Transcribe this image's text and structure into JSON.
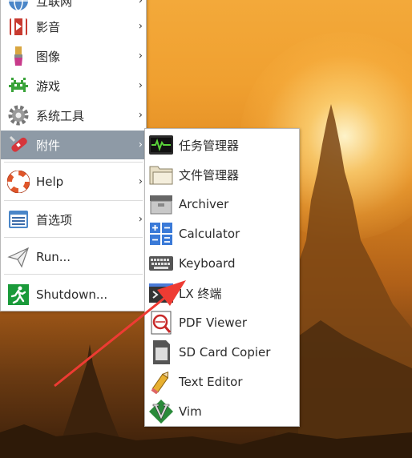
{
  "main_menu": {
    "items": [
      {
        "label": "互联网",
        "icon": "globe-icon"
      },
      {
        "label": "影音",
        "icon": "media-icon"
      },
      {
        "label": "图像",
        "icon": "paintbrush-icon"
      },
      {
        "label": "游戏",
        "icon": "space-invader-icon"
      },
      {
        "label": "系统工具",
        "icon": "gear-icon"
      },
      {
        "label": "附件",
        "icon": "swiss-knife-icon",
        "active": true
      },
      {
        "label": "Help",
        "icon": "lifebuoy-icon"
      },
      {
        "label": "首选项",
        "icon": "preferences-icon"
      },
      {
        "label": "Run...",
        "icon": "paper-plane-icon"
      },
      {
        "label": "Shutdown...",
        "icon": "exit-running-man-icon"
      }
    ],
    "submenu_arrow": "›"
  },
  "sub_menu": {
    "items": [
      {
        "label": "任务管理器",
        "icon": "task-manager-icon"
      },
      {
        "label": "文件管理器",
        "icon": "folder-icon"
      },
      {
        "label": "Archiver",
        "icon": "archive-box-icon"
      },
      {
        "label": "Calculator",
        "icon": "calculator-icon"
      },
      {
        "label": "Keyboard",
        "icon": "keyboard-icon"
      },
      {
        "label": "LX 终端",
        "icon": "terminal-icon"
      },
      {
        "label": "PDF Viewer",
        "icon": "pdf-viewer-icon"
      },
      {
        "label": "SD Card Copier",
        "icon": "sd-card-icon"
      },
      {
        "label": "Text Editor",
        "icon": "pencil-icon"
      },
      {
        "label": "Vim",
        "icon": "vim-icon"
      }
    ]
  },
  "colors": {
    "menu_bg": "#ffffff",
    "active_bg": "#8e9aa6",
    "annotation_arrow": "#ee3b33"
  }
}
